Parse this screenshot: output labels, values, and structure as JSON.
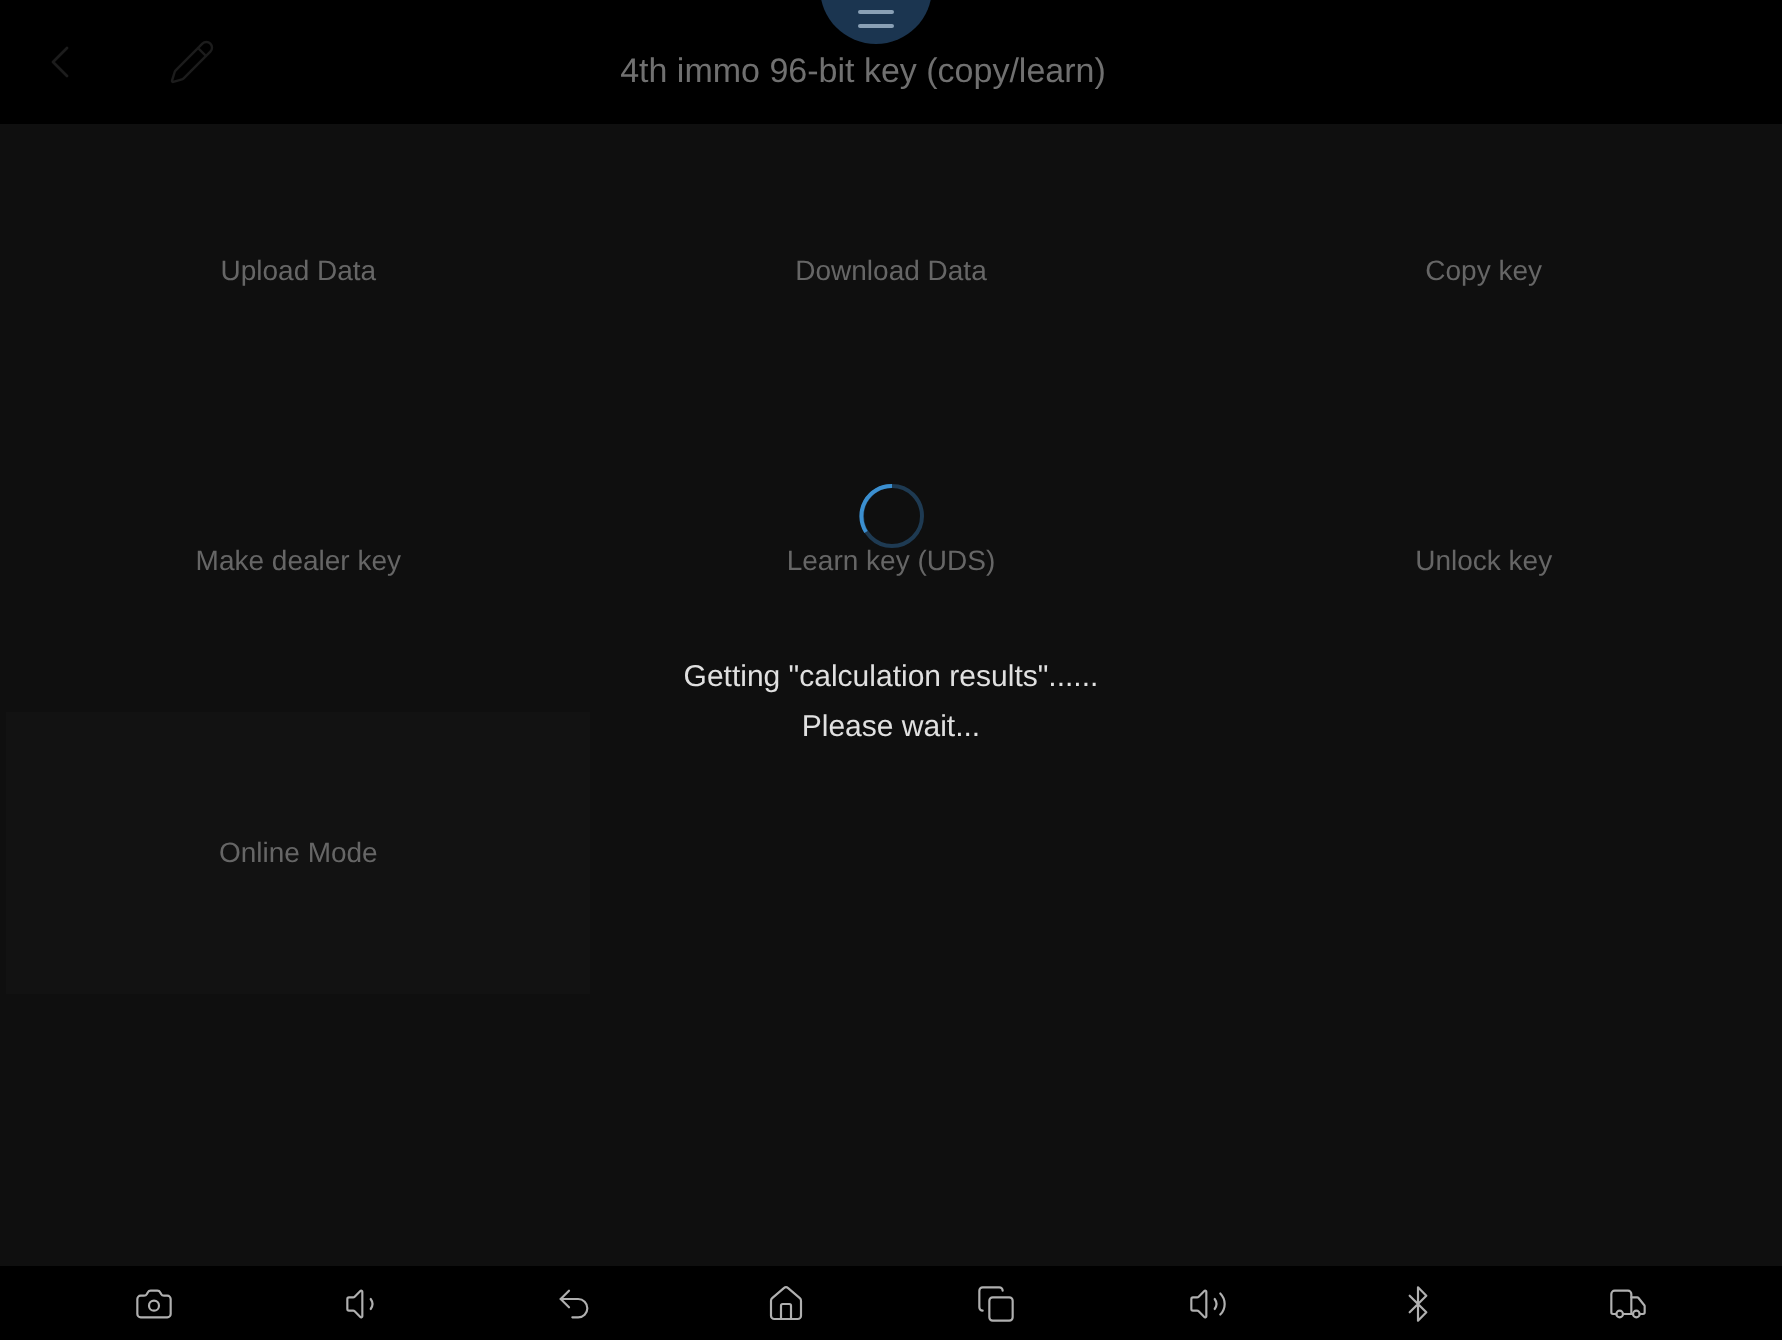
{
  "top_bar": {
    "title": "4th immo 96-bit key (copy/learn)"
  },
  "menu_items": [
    {
      "label": "Upload Data"
    },
    {
      "label": "Download Data"
    },
    {
      "label": "Copy key"
    },
    {
      "label": "Make dealer key"
    },
    {
      "label": "Learn key (UDS)"
    },
    {
      "label": "Unlock key"
    },
    {
      "label": "Online Mode"
    }
  ],
  "loading_dialog": {
    "message": "Getting \"calculation results\"......",
    "hint": "Please wait..."
  },
  "nav_bar": [
    {
      "kind": "screenshot"
    },
    {
      "kind": "volume_down"
    },
    {
      "kind": "back"
    },
    {
      "kind": "home"
    },
    {
      "kind": "recents"
    },
    {
      "kind": "volume_up"
    },
    {
      "kind": "vci"
    },
    {
      "kind": "truck"
    }
  ]
}
